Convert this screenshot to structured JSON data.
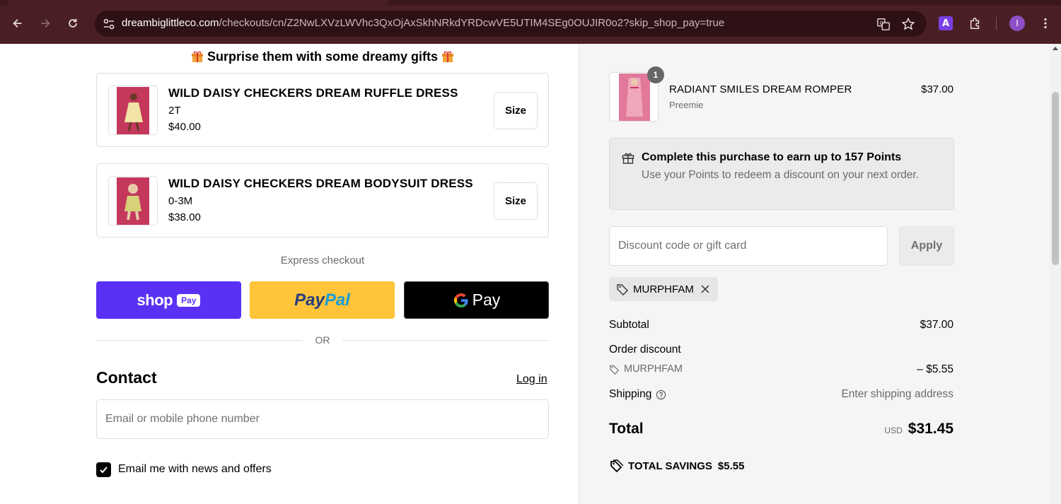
{
  "browser": {
    "url_host": "dreambiglittleco.com",
    "url_path": "/checkouts/cn/Z2NwLXVzLWVhc3QxOjAxSkhNRkdYRDcwVE5UTIM4SEg0OUJIR0o2?skip_shop_pay=true",
    "extension_badge": "A",
    "profile_initial": "I"
  },
  "gifts": {
    "title": "Surprise them with some dreamy gifts",
    "items": [
      {
        "name": "WILD DAISY CHECKERS DREAM RUFFLE DRESS",
        "variant": "2T",
        "price": "$40.00",
        "size_label": "Size"
      },
      {
        "name": "WILD DAISY CHECKERS DREAM BODYSUIT DRESS",
        "variant": "0-3M",
        "price": "$38.00",
        "size_label": "Size"
      }
    ]
  },
  "express": {
    "label": "Express checkout",
    "shop_word": "shop",
    "shop_chip": "Pay",
    "paypal_a": "Pay",
    "paypal_b": "Pal",
    "gpay_g": "G",
    "gpay_word": "Pay",
    "or": "OR"
  },
  "contact": {
    "heading": "Contact",
    "login": "Log in",
    "email_placeholder": "Email or mobile phone number",
    "news_label": "Email me with news and offers",
    "news_checked": true
  },
  "summary": {
    "item": {
      "qty": "1",
      "name": "RADIANT SMILES DREAM ROMPER",
      "variant": "Preemie",
      "price": "$37.00"
    },
    "points": {
      "title": "Complete this purchase to earn up to 157 Points",
      "desc": "Use your Points to redeem a discount on your next order."
    },
    "discount_placeholder": "Discount code or gift card",
    "apply_label": "Apply",
    "applied_code": "MURPHFAM",
    "subtotal_label": "Subtotal",
    "subtotal_value": "$37.00",
    "order_discount_label": "Order discount",
    "discount_code": "MURPHFAM",
    "discount_value": "– $5.55",
    "shipping_label": "Shipping",
    "shipping_value": "Enter shipping address",
    "total_label": "Total",
    "currency": "USD",
    "total_value": "$31.45",
    "savings_label": "TOTAL SAVINGS",
    "savings_value": "$5.55"
  },
  "colors": {
    "chrome": "#4a1f24",
    "shop_pay": "#5a31f4",
    "paypal": "#ffc439",
    "gpay": "#000000"
  }
}
